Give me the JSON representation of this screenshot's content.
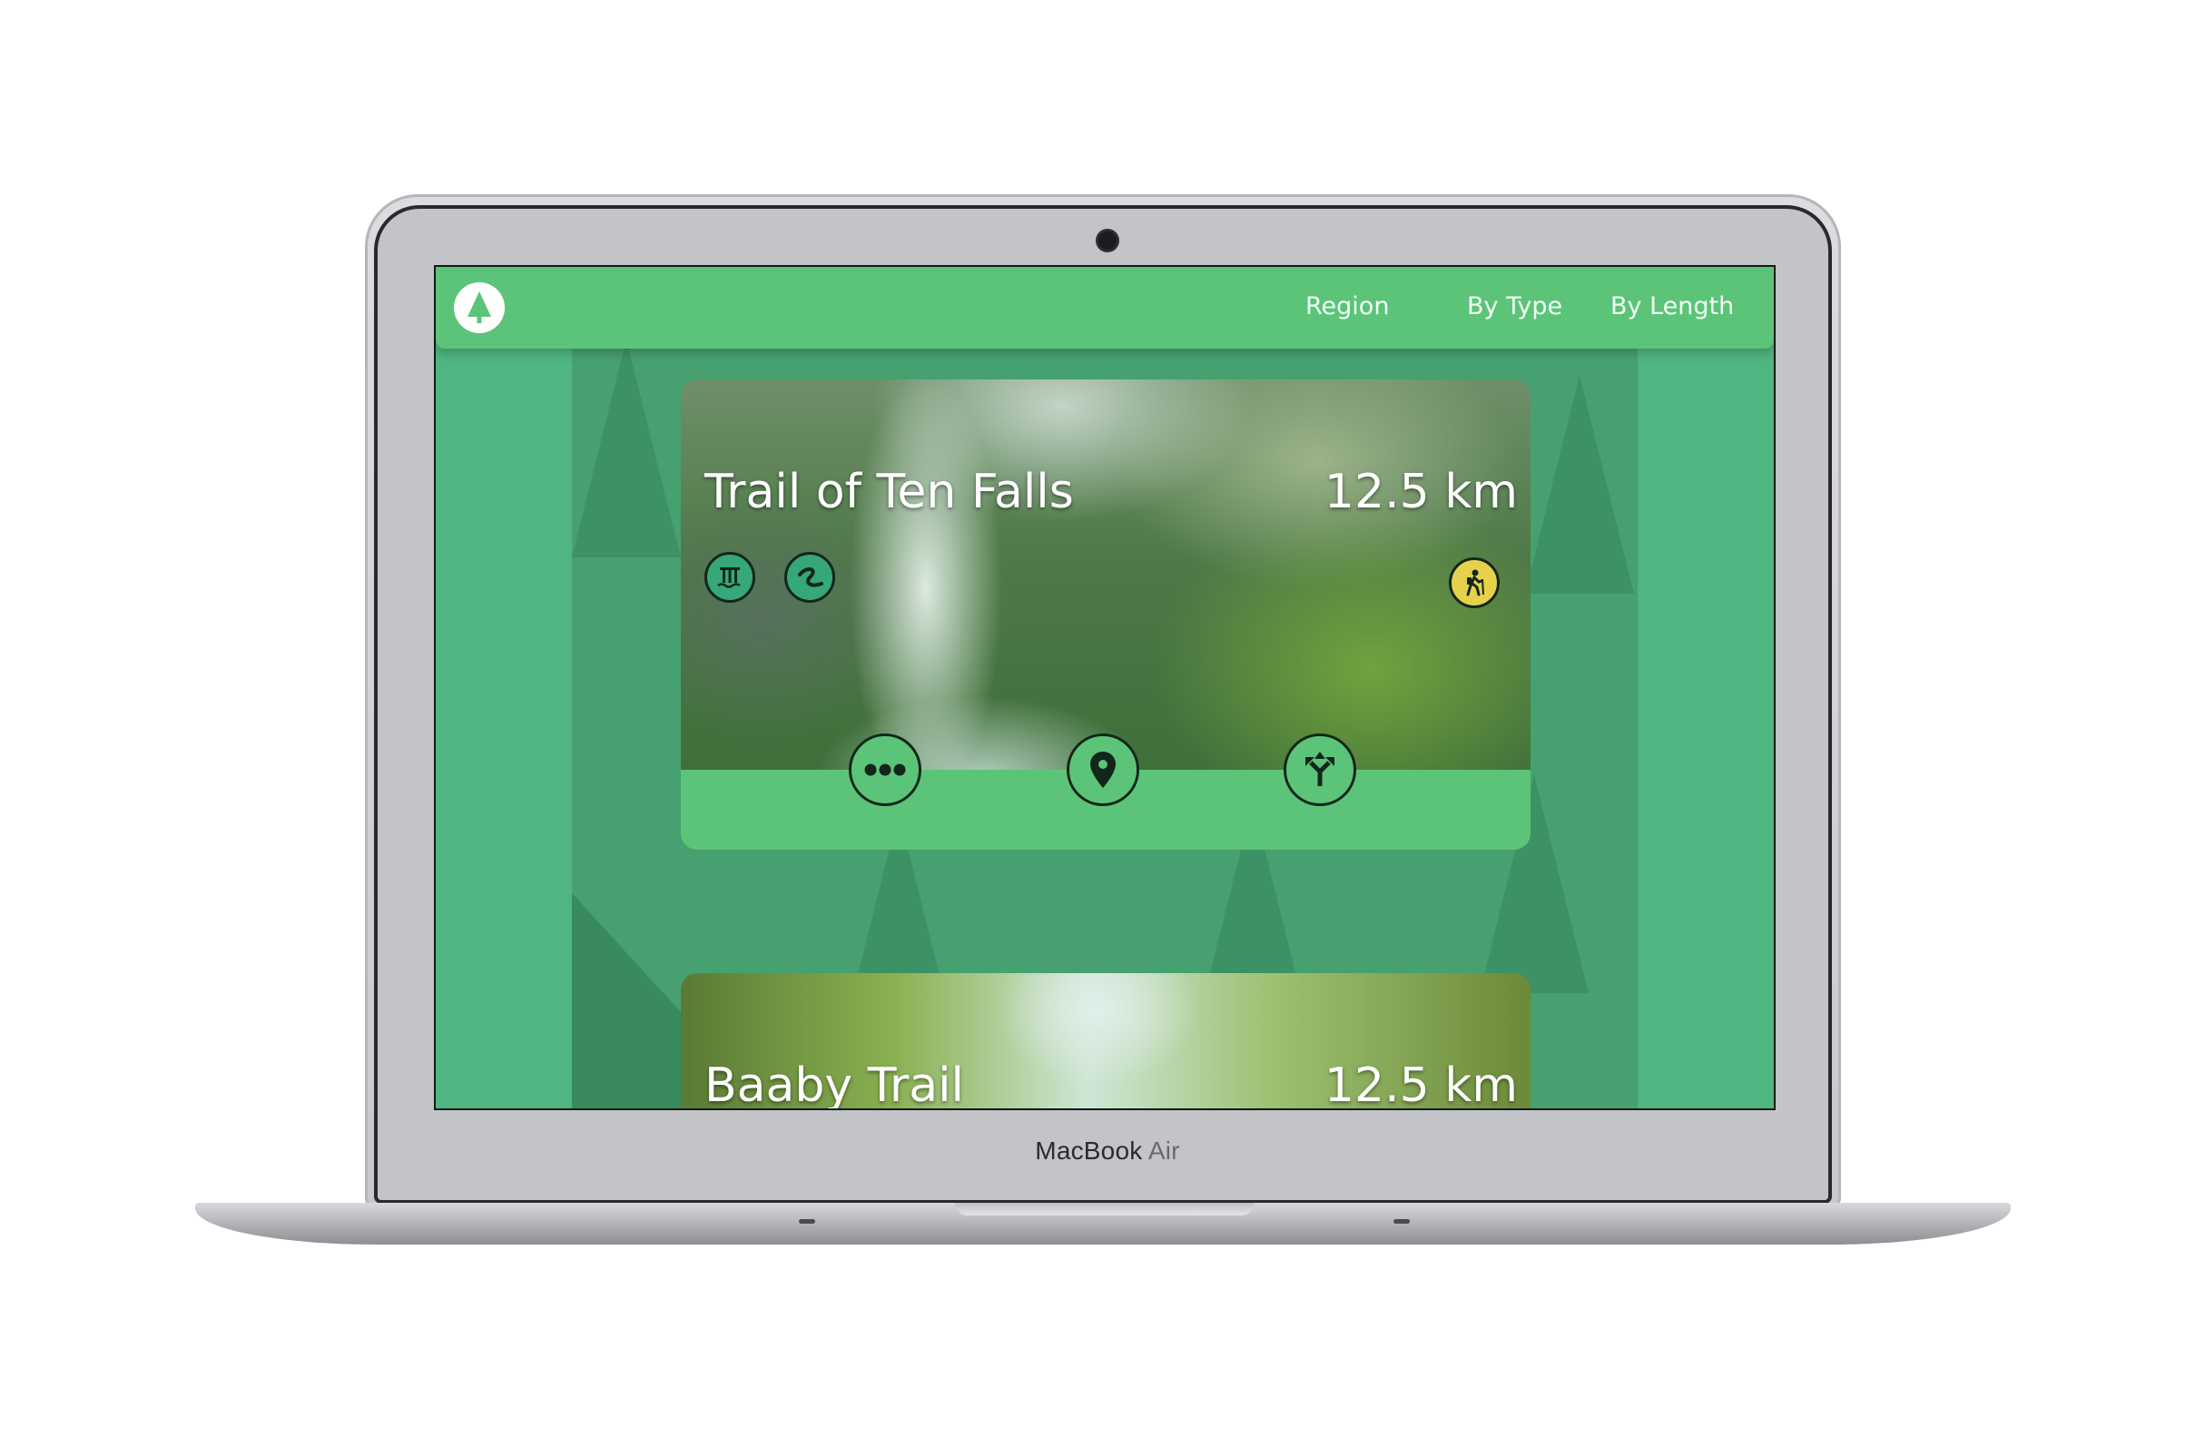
{
  "device": {
    "brand": "MacBook",
    "model": "Air"
  },
  "navbar": {
    "logo_icon": "pine-tree-icon",
    "links": [
      "Region",
      "By Type",
      "By Length"
    ]
  },
  "colors": {
    "primary_green": "#5cc479",
    "background_green": "#4fb581",
    "hiking_badge": "#e6d24a"
  },
  "trails": [
    {
      "name": "Trail of Ten Falls",
      "length": "12.5 km",
      "features": [
        "waterfall-icon",
        "river-icon"
      ],
      "activity": "hiking-icon",
      "actions": [
        "more-icon",
        "location-pin-icon",
        "directions-icon"
      ]
    },
    {
      "name": "Baaby Trail",
      "length": "12.5 km"
    }
  ]
}
